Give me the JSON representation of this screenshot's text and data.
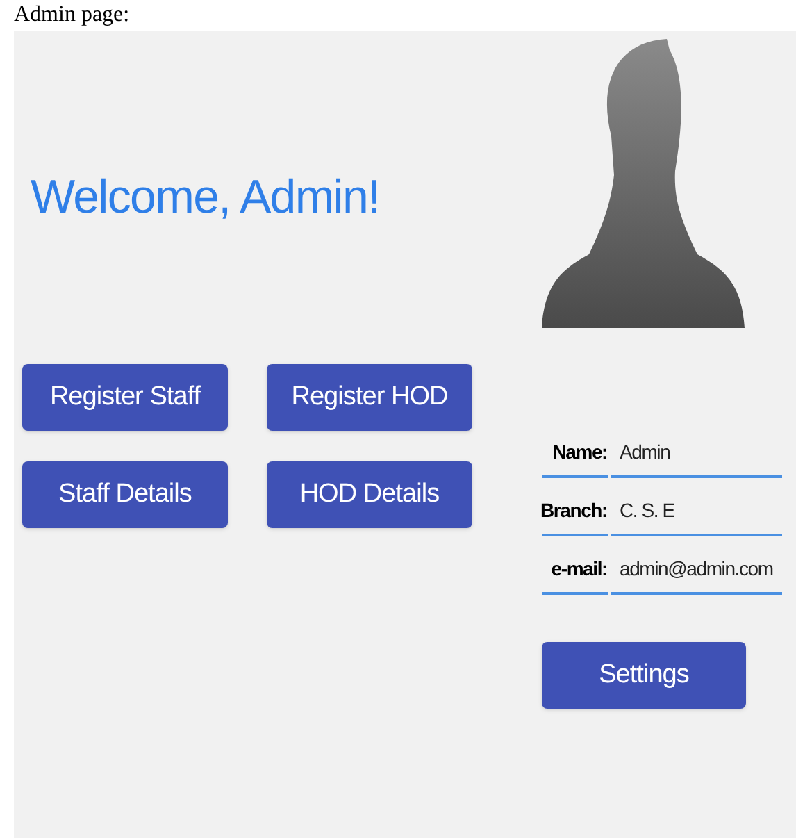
{
  "caption": "Admin page:",
  "welcome": "Welcome, Admin!",
  "buttons": [
    "Register Staff",
    "Register HOD",
    "Staff Details",
    "HOD Details"
  ],
  "profile": [
    {
      "label": "Name:",
      "value": "Admin"
    },
    {
      "label": "Branch:",
      "value": "C. S. E"
    },
    {
      "label": "e-mail:",
      "value": "admin@admin.com"
    }
  ],
  "settings_button": "Settings"
}
